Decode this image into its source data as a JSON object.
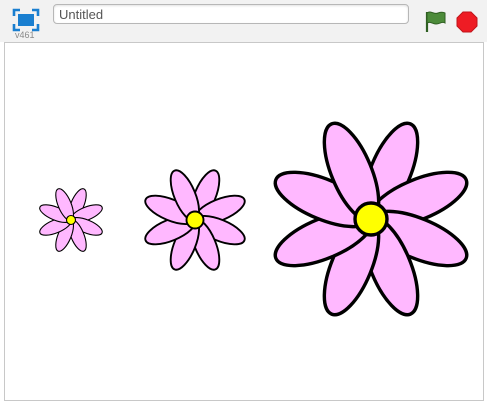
{
  "player": {
    "version": "v461",
    "title_value": "Untitled",
    "title_placeholder": ""
  },
  "icons": {
    "fullscreen": "fullscreen-icon",
    "green_flag": "green-flag-icon",
    "stop": "stop-sign-icon"
  },
  "colors": {
    "toolbar_bg": "#f2f2f2",
    "fullscreen_blue": "#1a7fd0",
    "flag_green": "#4c8b3a",
    "stop_red": "#ee1c24",
    "petal_fill": "#ffb8ff",
    "petal_stroke": "#000000",
    "center_fill": "#ffff00"
  },
  "stage": {
    "sprites": [
      {
        "name": "flower-small",
        "petals": 8
      },
      {
        "name": "flower-medium",
        "petals": 8
      },
      {
        "name": "flower-large",
        "petals": 8
      }
    ]
  }
}
